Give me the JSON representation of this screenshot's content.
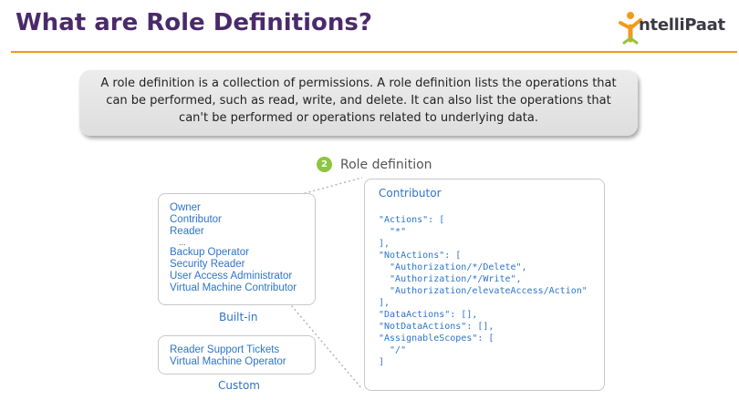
{
  "page": {
    "title": "What are Role Definitions?",
    "description": "A role definition is a collection of permissions. A role definition lists the operations that can be performed, such as read, write, and delete. It can also list the operations that can't be performed or operations related to underlying data."
  },
  "logo": {
    "text": "ntelliPaat",
    "primary_color": "#f39a1d"
  },
  "colors": {
    "title": "#4b2a6b",
    "rule": "#f39a1d",
    "accent_blue": "#2e74c8",
    "step_green": "#8dc63f"
  },
  "step": {
    "number": "2",
    "label": "Role definition"
  },
  "builtin": {
    "roles": [
      "Owner",
      "Contributor",
      "Reader",
      "...",
      "Backup Operator",
      "Security Reader",
      "User Access Administrator",
      "Virtual Machine Contributor"
    ],
    "caption": "Built-in"
  },
  "custom": {
    "roles": [
      "Reader Support Tickets",
      "Virtual Machine Operator"
    ],
    "caption": "Custom"
  },
  "definition": {
    "title": "Contributor",
    "json": "\"Actions\": [\n  \"*\"\n],\n\"NotActions\": [\n  \"Authorization/*/Delete\",\n  \"Authorization/*/Write\",\n  \"Authorization/elevateAccess/Action\"\n],\n\"DataActions\": [],\n\"NotDataActions\": [],\n\"AssignableScopes\": [\n  \"/\"\n]"
  }
}
